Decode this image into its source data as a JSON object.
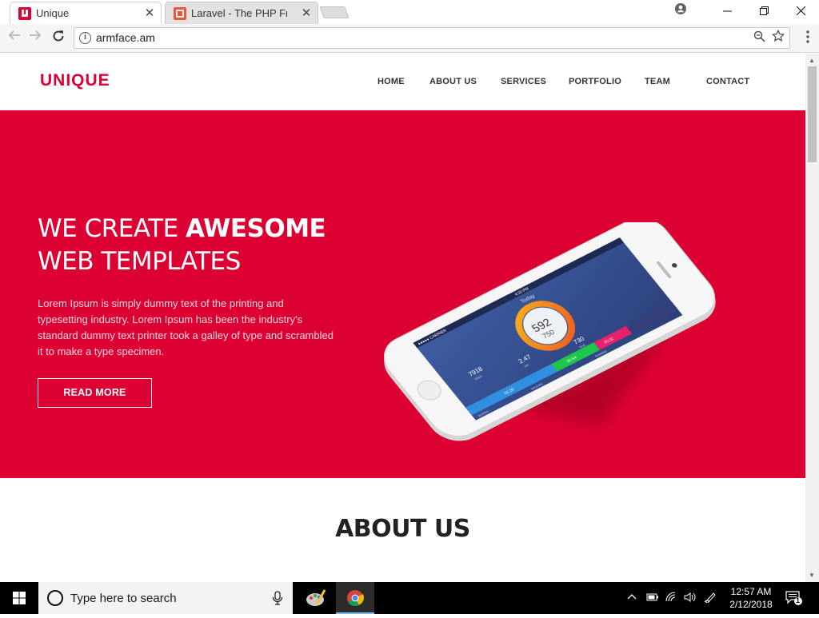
{
  "browser": {
    "tabs": [
      {
        "title": "Unique",
        "active": true
      },
      {
        "title": "Laravel - The PHP Framew",
        "active": false
      }
    ],
    "url": "armface.am"
  },
  "site": {
    "logo": "UNIQUE",
    "nav": [
      "HOME",
      "ABOUT US",
      "SERVICES",
      "PORTFOLIO",
      "TEAM",
      "CONTACT"
    ],
    "hero": {
      "title_line1_plain": "WE CREATE ",
      "title_line1_bold": "AWESOME",
      "title_line2": "WEB TEMPLATES",
      "description": "Lorem Ipsum is simply dummy text of the printing and typesetting industry. Lorem Ipsum has been the industry's standard dummy text printer took a galley of type and scrambled it to make a type specimen.",
      "button": "READ MORE"
    },
    "phone_screen": {
      "status_left": "●●●●● CARRIER",
      "status_time": "4:20 PM",
      "header": "Today",
      "big_number": "592",
      "small_number": "750",
      "stats": [
        {
          "value": "7918",
          "unit": "steps"
        },
        {
          "value": "2.47",
          "unit": "km"
        },
        {
          "value": "730",
          "unit": "kcal"
        }
      ],
      "bars": [
        {
          "value": "01:29",
          "label": "MOVING"
        },
        {
          "value": "00:54",
          "label": "WALKING"
        },
        {
          "value": "00:32",
          "label": "RUNNING"
        }
      ]
    },
    "section_title": "ABOUT US"
  },
  "taskbar": {
    "search_placeholder": "Type here to search",
    "time": "12:57 AM",
    "date": "2/12/2018",
    "notification_count": "1"
  },
  "colors": {
    "brand_red": "#dc0033",
    "white": "#ffffff"
  }
}
